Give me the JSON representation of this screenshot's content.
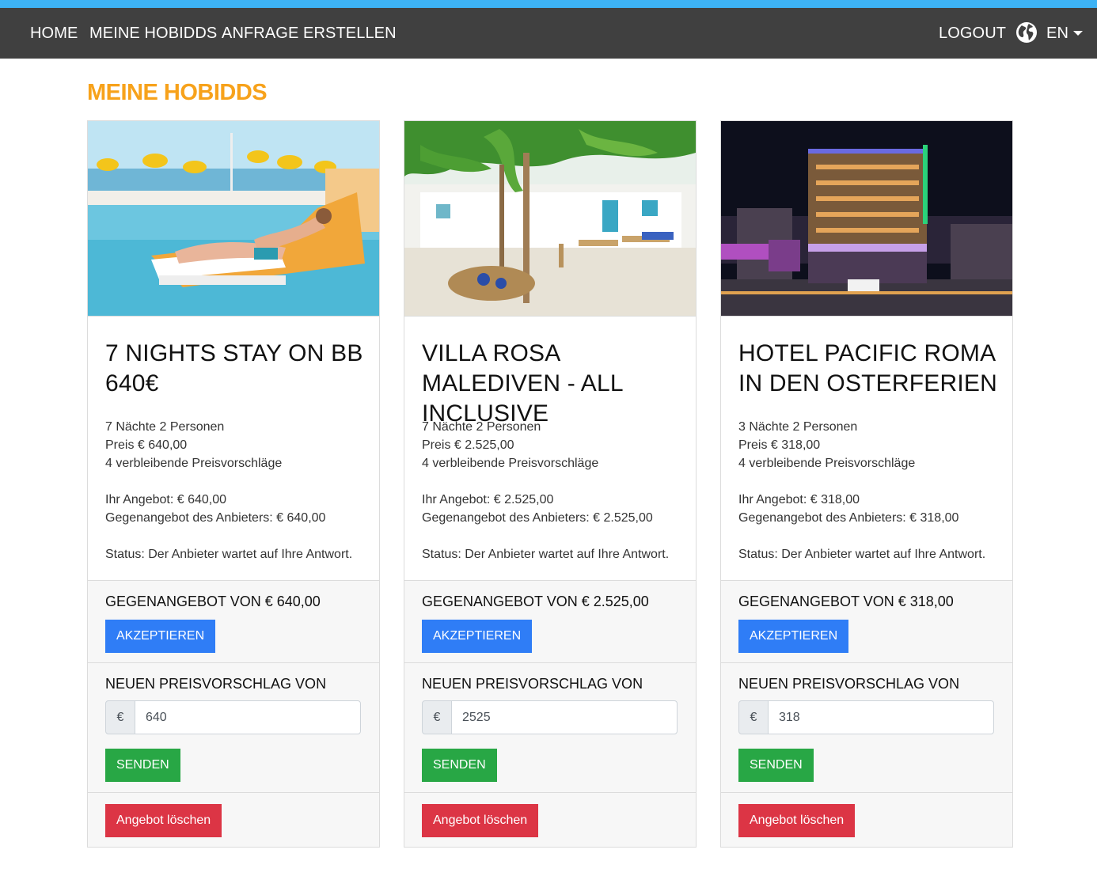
{
  "nav": {
    "links": [
      "HOME",
      "MEINE HOBIDDS",
      "ANFRAGE ERSTELLEN"
    ],
    "logout": "LOGOUT",
    "language": "EN",
    "accent_color": "#3db3f5",
    "bar_color": "#404040"
  },
  "page": {
    "title": "MEINE HOBIDDS",
    "title_color": "#f7a21b"
  },
  "labels": {
    "accept": "AKZEPTIEREN",
    "new_offer": "NEUEN PREISVORSCHLAG VON",
    "currency": "€",
    "send": "SENDEN",
    "delete": "Angebot löschen"
  },
  "cards": [
    {
      "image": "pool-beach-image",
      "title": "7 NIGHTS STAY ON BB 640€",
      "nights_persons": "7 Nächte 2 Personen",
      "price": "Preis € 640,00",
      "remaining": "4 verbleibende Preisvorschläge",
      "your_offer": "Ihr Angebot: € 640,00",
      "counter_offer": "Gegenangebot des Anbieters: € 640,00",
      "status": "Status: Der Anbieter wartet auf Ihre Antwort.",
      "counter_heading": "GEGENANGEBOT VON € 640,00",
      "input_value": "640"
    },
    {
      "image": "villa-garden-image",
      "title": "VILLA ROSA MALEDIVEN - ALL INCLUSIVE",
      "nights_persons": "7 Nächte 2 Personen",
      "price": "Preis € 2.525,00",
      "remaining": "4 verbleibende Preisvorschläge",
      "your_offer": "Ihr Angebot: € 2.525,00",
      "counter_offer": "Gegenangebot des Anbieters: € 2.525,00",
      "status": "Status: Der Anbieter wartet auf Ihre Antwort.",
      "counter_heading": "GEGENANGEBOT VON € 2.525,00",
      "input_value": "2525"
    },
    {
      "image": "hotel-night-image",
      "title": "HOTEL PACIFIC ROMA IN DEN OSTERFERIEN",
      "nights_persons": "3 Nächte 2 Personen",
      "price": "Preis € 318,00",
      "remaining": "4 verbleibende Preisvorschläge",
      "your_offer": "Ihr Angebot: € 318,00",
      "counter_offer": "Gegenangebot des Anbieters: € 318,00",
      "status": "Status: Der Anbieter wartet auf Ihre Antwort.",
      "counter_heading": "GEGENANGEBOT VON € 318,00",
      "input_value": "318"
    }
  ]
}
